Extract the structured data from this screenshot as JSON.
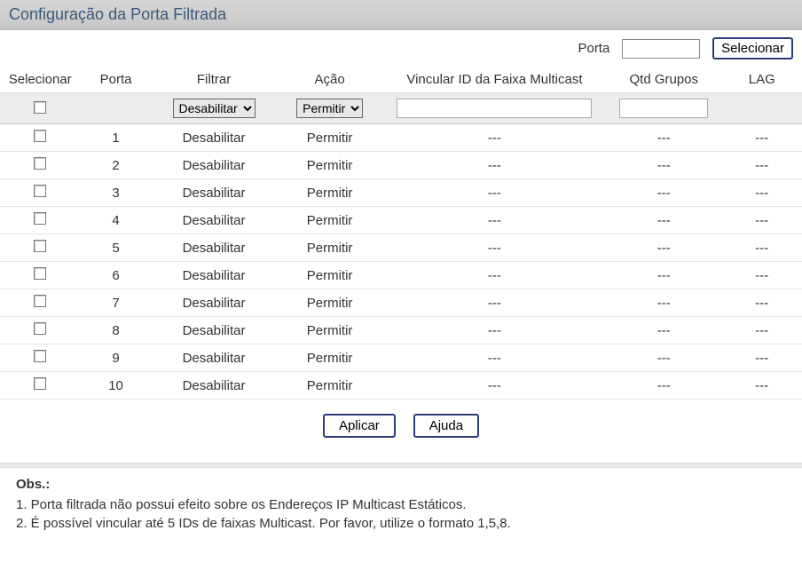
{
  "title": "Configuração da Porta Filtrada",
  "topbar": {
    "porta_label": "Porta",
    "porta_value": "",
    "select_btn": "Selecionar"
  },
  "headers": {
    "selecionar": "Selecionar",
    "porta": "Porta",
    "filtrar": "Filtrar",
    "acao": "Ação",
    "vincular": "Vincular ID da Faixa Multicast",
    "qtd": "Qtd Grupos",
    "lag": "LAG"
  },
  "controls": {
    "filtrar_selected": "Desabilitar",
    "acao_selected": "Permitir",
    "vincular_value": "",
    "qtd_value": ""
  },
  "rows": [
    {
      "porta": "1",
      "filtrar": "Desabilitar",
      "acao": "Permitir",
      "vincular": "---",
      "qtd": "---",
      "lag": "---"
    },
    {
      "porta": "2",
      "filtrar": "Desabilitar",
      "acao": "Permitir",
      "vincular": "---",
      "qtd": "---",
      "lag": "---"
    },
    {
      "porta": "3",
      "filtrar": "Desabilitar",
      "acao": "Permitir",
      "vincular": "---",
      "qtd": "---",
      "lag": "---"
    },
    {
      "porta": "4",
      "filtrar": "Desabilitar",
      "acao": "Permitir",
      "vincular": "---",
      "qtd": "---",
      "lag": "---"
    },
    {
      "porta": "5",
      "filtrar": "Desabilitar",
      "acao": "Permitir",
      "vincular": "---",
      "qtd": "---",
      "lag": "---"
    },
    {
      "porta": "6",
      "filtrar": "Desabilitar",
      "acao": "Permitir",
      "vincular": "---",
      "qtd": "---",
      "lag": "---"
    },
    {
      "porta": "7",
      "filtrar": "Desabilitar",
      "acao": "Permitir",
      "vincular": "---",
      "qtd": "---",
      "lag": "---"
    },
    {
      "porta": "8",
      "filtrar": "Desabilitar",
      "acao": "Permitir",
      "vincular": "---",
      "qtd": "---",
      "lag": "---"
    },
    {
      "porta": "9",
      "filtrar": "Desabilitar",
      "acao": "Permitir",
      "vincular": "---",
      "qtd": "---",
      "lag": "---"
    },
    {
      "porta": "10",
      "filtrar": "Desabilitar",
      "acao": "Permitir",
      "vincular": "---",
      "qtd": "---",
      "lag": "---"
    }
  ],
  "buttons": {
    "apply": "Aplicar",
    "help": "Ajuda"
  },
  "notes": {
    "heading": "Obs.:",
    "line1": "1. Porta filtrada não possui efeito sobre os Endereços IP Multicast Estáticos.",
    "line2": "2. É possível vincular até 5 IDs de faixas Multicast. Por favor, utilize o formato 1,5,8."
  }
}
